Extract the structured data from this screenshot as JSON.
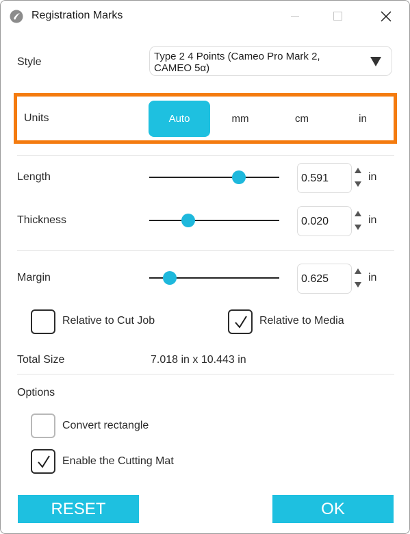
{
  "window": {
    "title": "Registration Marks"
  },
  "style": {
    "label": "Style",
    "selected_value": "Type 2 4 Points (Cameo Pro Mark 2, CAMEO 5α)"
  },
  "units": {
    "label": "Units",
    "options": [
      "Auto",
      "mm",
      "cm",
      "in"
    ],
    "selected": "Auto",
    "highlight_color": "#f47b0f"
  },
  "length": {
    "label": "Length",
    "value": "0.591",
    "unit": "in",
    "slider_fraction": 0.69
  },
  "thickness": {
    "label": "Thickness",
    "value": "0.020",
    "unit": "in",
    "slider_fraction": 0.3
  },
  "margin": {
    "label": "Margin",
    "value": "0.625",
    "unit": "in",
    "slider_fraction": 0.16
  },
  "relative": {
    "cut_job": {
      "label": "Relative to Cut Job",
      "checked": false
    },
    "media": {
      "label": "Relative to Media",
      "checked": true
    }
  },
  "total_size": {
    "label": "Total Size",
    "value": "7.018 in x 10.443 in"
  },
  "options": {
    "label": "Options",
    "convert_rectangle": {
      "label": "Convert rectangle",
      "checked": false
    },
    "enable_cutting_mat": {
      "label": "Enable the Cutting Mat",
      "checked": true
    }
  },
  "buttons": {
    "reset_label": "RESET",
    "ok_label": "OK"
  },
  "colors": {
    "accent": "#1ec0e0",
    "outline": "#f47b0f"
  }
}
